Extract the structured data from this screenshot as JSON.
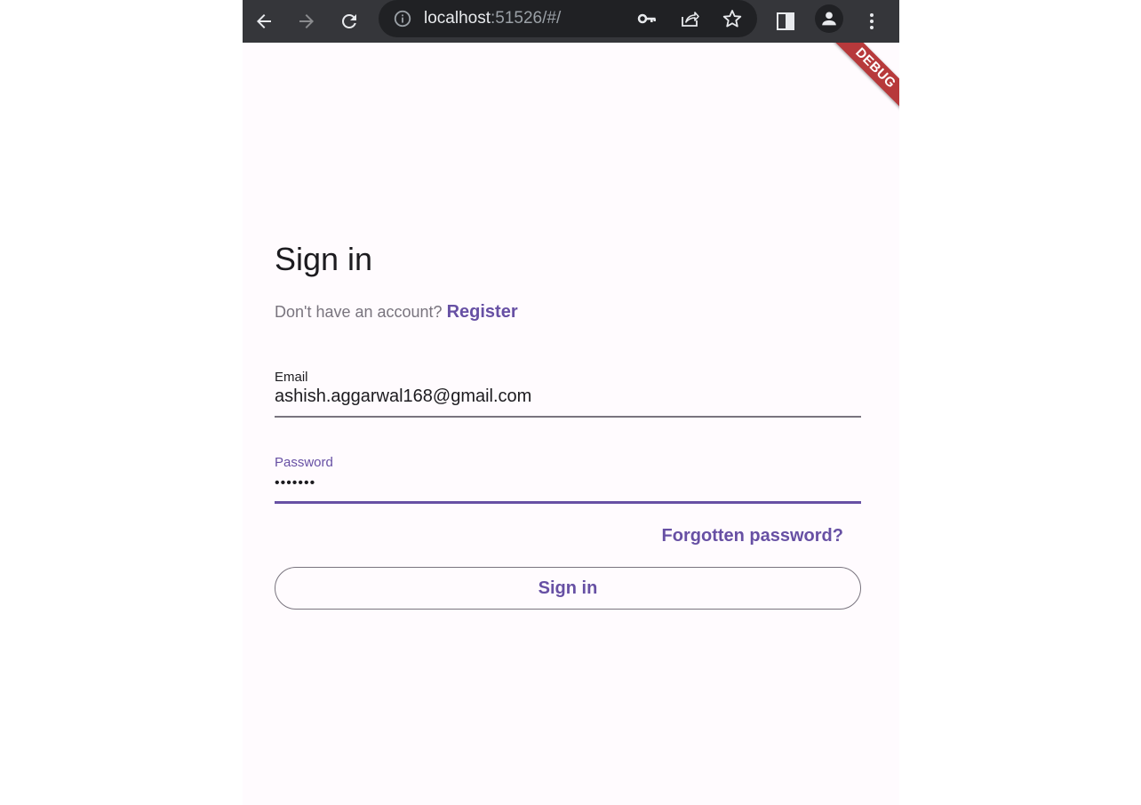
{
  "browser": {
    "url_host": "localhost",
    "url_rest": ":51526/#/",
    "icons": [
      "back-arrow-icon",
      "forward-arrow-icon",
      "reload-icon",
      "info-icon",
      "key-icon",
      "share-icon",
      "star-icon",
      "side-panel-icon",
      "profile-icon",
      "more-vert-icon"
    ]
  },
  "debug_banner": {
    "label": "DEBUG"
  },
  "signin": {
    "title": "Sign in",
    "no_account_text": "Don't have an account?",
    "register_link": "Register",
    "email": {
      "label": "Email",
      "value": "ashish.aggarwal168@gmail.com"
    },
    "password": {
      "label": "Password",
      "value": "•••••••"
    },
    "forgot_link": "Forgotten password?",
    "submit_label": "Sign in"
  },
  "colors": {
    "primary": "#6750a4",
    "surface": "#fffbfe",
    "outline": "#79747e",
    "on_surface": "#1c1b1f",
    "toolbar": "#35363a",
    "debug_ribbon": "#b7393b"
  }
}
